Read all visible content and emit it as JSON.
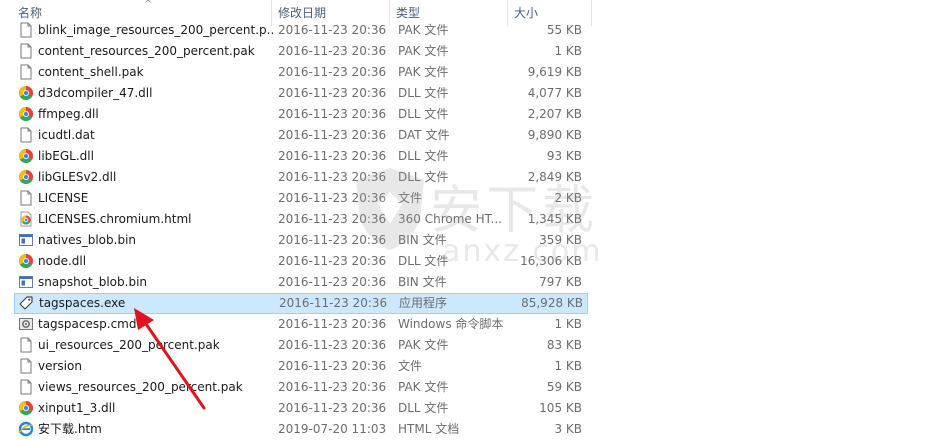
{
  "header": {
    "name": "名称",
    "date": "修改日期",
    "type": "类型",
    "size": "大小"
  },
  "files": [
    {
      "name": "blink_image_resources_200_percent.p...",
      "date": "2016-11-23 20:36",
      "type": "PAK 文件",
      "size": "55 KB",
      "icon": "file-icon"
    },
    {
      "name": "content_resources_200_percent.pak",
      "date": "2016-11-23 20:36",
      "type": "PAK 文件",
      "size": "1 KB",
      "icon": "file-icon"
    },
    {
      "name": "content_shell.pak",
      "date": "2016-11-23 20:36",
      "type": "PAK 文件",
      "size": "9,619 KB",
      "icon": "file-icon"
    },
    {
      "name": "d3dcompiler_47.dll",
      "date": "2016-11-23 20:36",
      "type": "DLL 文件",
      "size": "4,077 KB",
      "icon": "dll-icon"
    },
    {
      "name": "ffmpeg.dll",
      "date": "2016-11-23 20:36",
      "type": "DLL 文件",
      "size": "2,207 KB",
      "icon": "dll-icon"
    },
    {
      "name": "icudtl.dat",
      "date": "2016-11-23 20:36",
      "type": "DAT 文件",
      "size": "9,890 KB",
      "icon": "file-icon"
    },
    {
      "name": "libEGL.dll",
      "date": "2016-11-23 20:36",
      "type": "DLL 文件",
      "size": "93 KB",
      "icon": "dll-icon"
    },
    {
      "name": "libGLESv2.dll",
      "date": "2016-11-23 20:36",
      "type": "DLL 文件",
      "size": "2,849 KB",
      "icon": "dll-icon"
    },
    {
      "name": "LICENSE",
      "date": "2016-11-23 20:36",
      "type": "文件",
      "size": "2 KB",
      "icon": "file-icon"
    },
    {
      "name": "LICENSES.chromium.html",
      "date": "2016-11-23 20:36",
      "type": "360 Chrome HT...",
      "size": "1,345 KB",
      "icon": "chrome-html-icon"
    },
    {
      "name": "natives_blob.bin",
      "date": "2016-11-23 20:36",
      "type": "BIN 文件",
      "size": "359 KB",
      "icon": "bin-icon"
    },
    {
      "name": "node.dll",
      "date": "2016-11-23 20:36",
      "type": "DLL 文件",
      "size": "16,306 KB",
      "icon": "dll-icon"
    },
    {
      "name": "snapshot_blob.bin",
      "date": "2016-11-23 20:36",
      "type": "BIN 文件",
      "size": "797 KB",
      "icon": "bin-icon"
    },
    {
      "name": "tagspaces.exe",
      "date": "2016-11-23 20:36",
      "type": "应用程序",
      "size": "85,928 KB",
      "icon": "tag-exe-icon",
      "selected": true
    },
    {
      "name": "tagspacesp.cmd",
      "date": "2016-11-23 20:36",
      "type": "Windows 命令脚本",
      "size": "1 KB",
      "icon": "cmd-icon"
    },
    {
      "name": "ui_resources_200_percent.pak",
      "date": "2016-11-23 20:36",
      "type": "PAK 文件",
      "size": "83 KB",
      "icon": "file-icon"
    },
    {
      "name": "version",
      "date": "2016-11-23 20:36",
      "type": "文件",
      "size": "1 KB",
      "icon": "file-icon"
    },
    {
      "name": "views_resources_200_percent.pak",
      "date": "2016-11-23 20:36",
      "type": "PAK 文件",
      "size": "59 KB",
      "icon": "file-icon"
    },
    {
      "name": "xinput1_3.dll",
      "date": "2016-11-23 20:36",
      "type": "DLL 文件",
      "size": "105 KB",
      "icon": "dll-icon"
    },
    {
      "name": "安下载.htm",
      "date": "2019-07-20 11:03",
      "type": "HTML 文档",
      "size": "3 KB",
      "icon": "ie-htm-icon"
    }
  ],
  "watermark": {
    "main": "安下载",
    "sub": "anxz.com"
  },
  "colors": {
    "selection_bg": "#cce8ff",
    "selection_border": "#99d1ff",
    "arrow": "#e0141e",
    "header_text": "#4c607a"
  }
}
